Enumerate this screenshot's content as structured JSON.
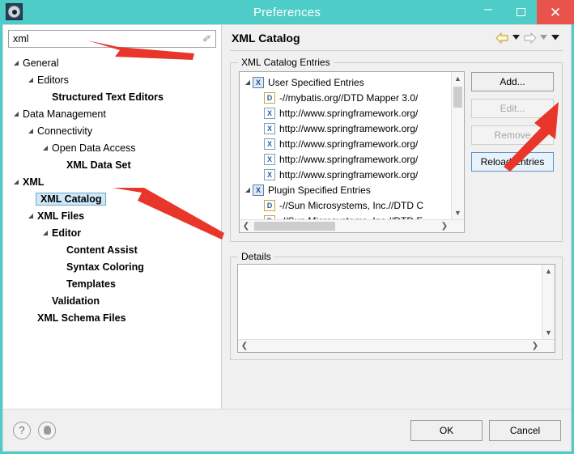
{
  "window": {
    "title": "Preferences",
    "app_icon": "gear-icon",
    "controls": {
      "minimize": "–",
      "maximize": "□",
      "close": "✕"
    },
    "titlebar_color": "#4ECDC8",
    "close_color": "#e8544b"
  },
  "search": {
    "value": "xml",
    "placeholder": "type filter text",
    "clear_icon": "clear-filter-icon"
  },
  "sidebar": {
    "items": [
      {
        "label": "General",
        "indent": 0,
        "arrow": "expanded",
        "bold": false,
        "selected": false
      },
      {
        "label": "Editors",
        "indent": 1,
        "arrow": "expanded",
        "bold": false,
        "selected": false
      },
      {
        "label": "Structured Text Editors",
        "indent": 2,
        "arrow": "none",
        "bold": true,
        "selected": false
      },
      {
        "label": "Data Management",
        "indent": 0,
        "arrow": "expanded",
        "bold": false,
        "selected": false
      },
      {
        "label": "Connectivity",
        "indent": 1,
        "arrow": "expanded",
        "bold": false,
        "selected": false
      },
      {
        "label": "Open Data Access",
        "indent": 2,
        "arrow": "expanded",
        "bold": false,
        "selected": false
      },
      {
        "label": "XML Data Set",
        "indent": 3,
        "arrow": "none",
        "bold": true,
        "selected": false
      },
      {
        "label": "XML",
        "indent": 0,
        "arrow": "expanded",
        "bold": true,
        "selected": false
      },
      {
        "label": "XML Catalog",
        "indent": 1,
        "arrow": "none",
        "bold": true,
        "selected": true
      },
      {
        "label": "XML Files",
        "indent": 1,
        "arrow": "expanded",
        "bold": true,
        "selected": false
      },
      {
        "label": "Editor",
        "indent": 2,
        "arrow": "expanded",
        "bold": true,
        "selected": false
      },
      {
        "label": "Content Assist",
        "indent": 3,
        "arrow": "none",
        "bold": true,
        "selected": false
      },
      {
        "label": "Syntax Coloring",
        "indent": 3,
        "arrow": "none",
        "bold": true,
        "selected": false
      },
      {
        "label": "Templates",
        "indent": 3,
        "arrow": "none",
        "bold": true,
        "selected": false
      },
      {
        "label": "Validation",
        "indent": 2,
        "arrow": "none",
        "bold": true,
        "selected": false
      },
      {
        "label": "XML Schema Files",
        "indent": 1,
        "arrow": "none",
        "bold": true,
        "selected": false
      }
    ]
  },
  "page": {
    "title": "XML Catalog",
    "nav": {
      "back_icon": "back-arrow-icon",
      "back_menu_icon": "chevron-down-icon",
      "forward_icon": "forward-arrow-icon",
      "forward_menu_icon": "chevron-down-icon",
      "view_menu_icon": "chevron-down-icon"
    }
  },
  "catalog": {
    "group_label": "XML Catalog Entries",
    "entries": [
      {
        "icon": "catalog-group-icon",
        "icon_kind": "group",
        "text": "User Specified Entries",
        "child": false,
        "arrow": "expanded"
      },
      {
        "icon": "dtd-entry-icon",
        "icon_kind": "dtd",
        "text": "-//mybatis.org//DTD Mapper 3.0/",
        "child": true,
        "arrow": "none"
      },
      {
        "icon": "xsd-entry-icon",
        "icon_kind": "xsd",
        "text": "http://www.springframework.org/",
        "child": true,
        "arrow": "none"
      },
      {
        "icon": "xsd-entry-icon",
        "icon_kind": "xsd",
        "text": "http://www.springframework.org/",
        "child": true,
        "arrow": "none"
      },
      {
        "icon": "xsd-entry-icon",
        "icon_kind": "xsd",
        "text": "http://www.springframework.org/",
        "child": true,
        "arrow": "none"
      },
      {
        "icon": "xsd-entry-icon",
        "icon_kind": "xsd",
        "text": "http://www.springframework.org/",
        "child": true,
        "arrow": "none"
      },
      {
        "icon": "xsd-entry-icon",
        "icon_kind": "xsd",
        "text": "http://www.springframework.org/",
        "child": true,
        "arrow": "none"
      },
      {
        "icon": "catalog-group-icon",
        "icon_kind": "group",
        "text": "Plugin Specified Entries",
        "child": false,
        "arrow": "expanded"
      },
      {
        "icon": "dtd-entry-icon",
        "icon_kind": "dtd",
        "text": "-//Sun Microsystems, Inc.//DTD C",
        "child": true,
        "arrow": "none"
      },
      {
        "icon": "dtd-entry-icon",
        "icon_kind": "dtd",
        "text": "-//Sun Microsystems, Inc.//DTD E",
        "child": true,
        "arrow": "none"
      }
    ],
    "buttons": [
      {
        "label": "Add...",
        "state": "normal"
      },
      {
        "label": "Edit...",
        "state": "disabled"
      },
      {
        "label": "Remove",
        "state": "disabled"
      },
      {
        "label": "Reload Entries",
        "state": "focused"
      }
    ],
    "scroll": {
      "up_icon": "scroll-up-icon",
      "down_icon": "scroll-down-icon",
      "left_icon": "scroll-left-icon",
      "right_icon": "scroll-right-icon"
    }
  },
  "details": {
    "group_label": "Details",
    "value": "",
    "scroll": {
      "up_icon": "scroll-up-icon",
      "down_icon": "scroll-down-icon",
      "left_icon": "scroll-left-icon",
      "right_icon": "scroll-right-icon"
    }
  },
  "footer": {
    "help_icon": "help-icon",
    "restore_icon": "restore-defaults-icon",
    "ok_label": "OK",
    "cancel_label": "Cancel"
  },
  "annotations": {
    "color": "#e8362a",
    "arrows": [
      {
        "name": "arrow-to-search-field"
      },
      {
        "name": "arrow-to-xml-catalog-tree-item"
      },
      {
        "name": "arrow-to-add-button"
      }
    ]
  }
}
